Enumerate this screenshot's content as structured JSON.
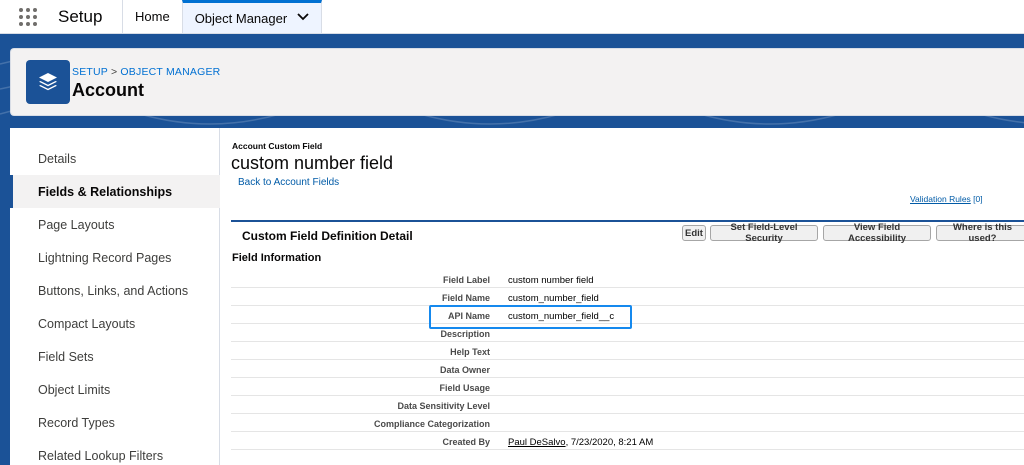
{
  "topbar": {
    "app_name": "Setup",
    "tabs": [
      {
        "label": "Home"
      },
      {
        "label": "Object Manager"
      }
    ]
  },
  "header": {
    "breadcrumb": [
      "SETUP",
      "OBJECT MANAGER"
    ],
    "breadcrumb_sep": ">",
    "title": "Account"
  },
  "sidebar": {
    "items": [
      {
        "label": "Details"
      },
      {
        "label": "Fields & Relationships"
      },
      {
        "label": "Page Layouts"
      },
      {
        "label": "Lightning Record Pages"
      },
      {
        "label": "Buttons, Links, and Actions"
      },
      {
        "label": "Compact Layouts"
      },
      {
        "label": "Field Sets"
      },
      {
        "label": "Object Limits"
      },
      {
        "label": "Record Types"
      },
      {
        "label": "Related Lookup Filters"
      }
    ],
    "active_index": 1
  },
  "content": {
    "eyebrow": "Account Custom Field",
    "title": "custom number field",
    "back_link": "Back to Account Fields",
    "validation_link": "Validation Rules",
    "validation_count": "[0]",
    "detail_title": "Custom Field Definition Detail",
    "buttons": {
      "edit": "Edit",
      "security": "Set Field-Level Security",
      "accessibility": "View Field Accessibility",
      "where_used": "Where is this used?"
    },
    "section_title": "Field Information",
    "fields": [
      {
        "label": "Field Label",
        "value": "custom number field"
      },
      {
        "label": "Field Name",
        "value": "custom_number_field"
      },
      {
        "label": "API Name",
        "value": "custom_number_field__c"
      },
      {
        "label": "Description",
        "value": ""
      },
      {
        "label": "Help Text",
        "value": ""
      },
      {
        "label": "Data Owner",
        "value": ""
      },
      {
        "label": "Field Usage",
        "value": ""
      },
      {
        "label": "Data Sensitivity Level",
        "value": ""
      },
      {
        "label": "Compliance Categorization",
        "value": ""
      },
      {
        "label": "Created By",
        "value": ""
      }
    ],
    "created_by_user": "Paul DeSalvo",
    "created_by_date": ", 7/23/2020, 8:21 AM"
  },
  "colors": {
    "brand_blue": "#1b5297",
    "link_blue": "#0070d2",
    "highlight_blue": "#1589ee"
  }
}
